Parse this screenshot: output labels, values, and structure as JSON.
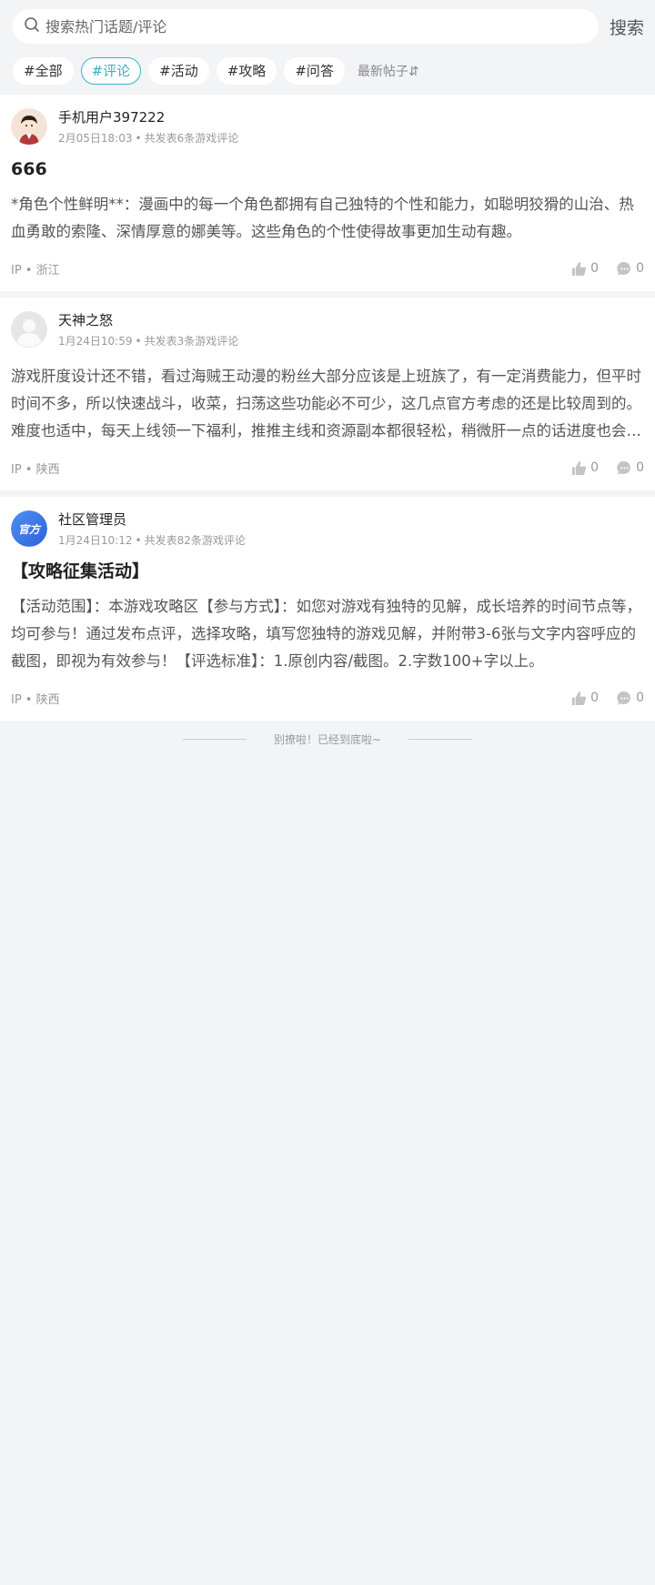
{
  "search": {
    "placeholder": "搜索热门话题/评论",
    "button": "搜索"
  },
  "tags": [
    "#全部",
    "#评论",
    "#活动",
    "#攻略",
    "#问答"
  ],
  "sort_label": "最新帖子⇵",
  "posts": [
    {
      "user": "手机用户397222",
      "date": "2月05日18:03",
      "count": "共发表6条游戏评论",
      "title": "666",
      "body": "*角色个性鲜明**：漫画中的每一个角色都拥有自己独特的个性和能力，如聪明狡猾的山治、热血勇敢的索隆、深情厚意的娜美等。这些角色的个性使得故事更加生动有趣。",
      "ip": "IP • 浙江",
      "likes": "0",
      "comments": "0"
    },
    {
      "user": "天神之怒",
      "date": "1月24日10:59",
      "count": "共发表3条游戏评论",
      "title": "",
      "body": "游戏肝度设计还不错，看过海贼王动漫的粉丝大部分应该是上班族了，有一定消费能力，但平时时间不多，所以快速战斗，收菜，扫荡这些功能必不可少，这几点官方考虑的还是比较周到的。难度也适中，每天上线领一下福利，推推主线和资源副本都很轻松，稍微肝一点的话进度也会比较快。",
      "ip": "IP • 陕西",
      "likes": "0",
      "comments": "0"
    },
    {
      "user": "社区管理员",
      "date": "1月24日10:12",
      "count": "共发表82条游戏评论",
      "badge": "官方",
      "title": "【攻略征集活动】",
      "body": "【活动范围】：本游戏攻略区【参与方式】：如您对游戏有独特的见解，成长培养的时间节点等，均可参与！通过发布点评，选择攻略，填写您独特的游戏见解，并附带3-6张与文字内容呼应的截图，即视为有效参与！【评选标准】：1.原创内容/截图。2.字数100+字以上。",
      "ip": "IP • 陕西",
      "likes": "0",
      "comments": "0"
    }
  ],
  "end_text": "别撩啦！已经到底啦~",
  "colors": {
    "accent": "#38b2c6",
    "background": "#f3f4f6",
    "official_badge": "#3b7bea"
  }
}
